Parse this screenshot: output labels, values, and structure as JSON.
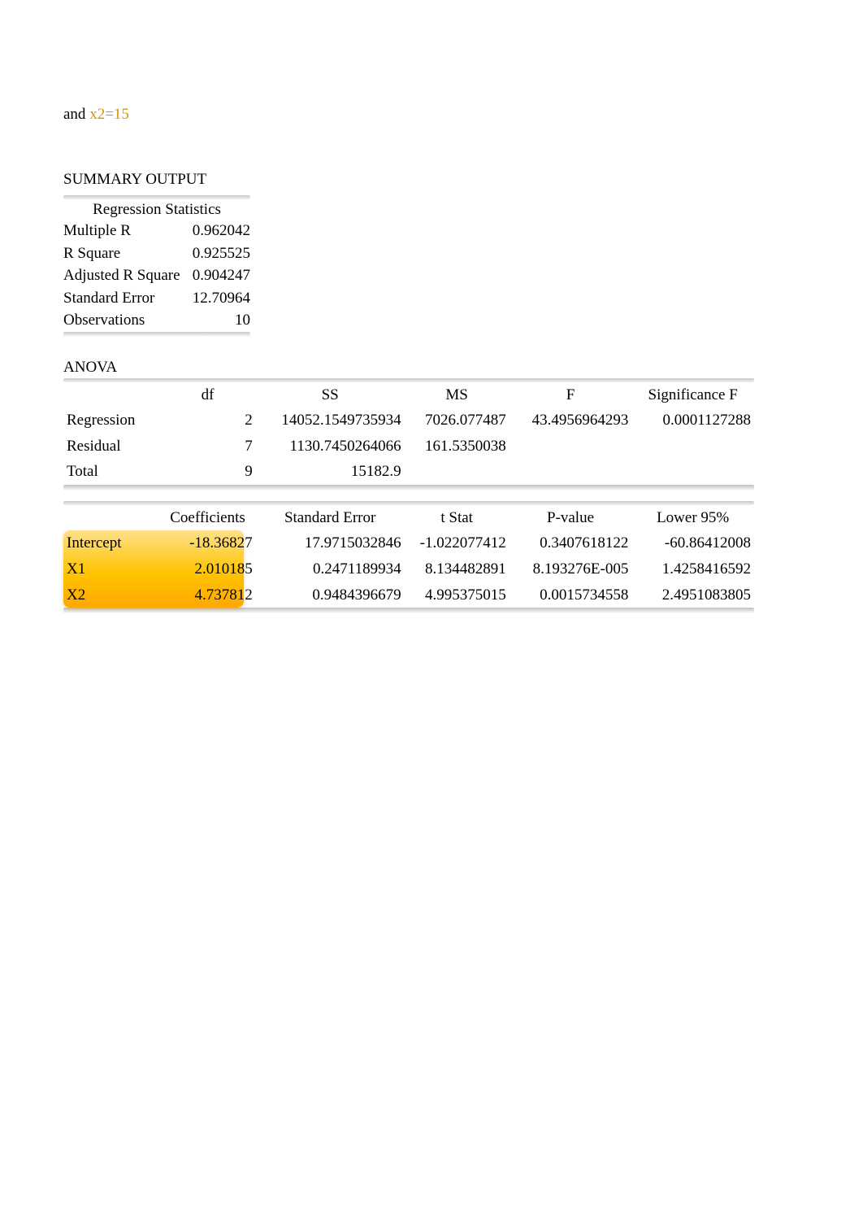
{
  "intro": {
    "and": "and",
    "equation": "x2=15"
  },
  "summary_title": "SUMMARY OUTPUT",
  "regression_stats": {
    "header": "Regression Statistics",
    "rows": [
      {
        "label": "Multiple R",
        "value": "0.962042"
      },
      {
        "label": "R Square",
        "value": "0.925525"
      },
      {
        "label": "Adjusted R Square",
        "value": "0.904247"
      },
      {
        "label": "Standard Error",
        "value": "12.70964"
      },
      {
        "label": "Observations",
        "value": "10"
      }
    ]
  },
  "anova": {
    "title": "ANOVA",
    "headers": {
      "df": "df",
      "ss": "SS",
      "ms": "MS",
      "f": "F",
      "sig": "Significance F"
    },
    "rows": [
      {
        "label": "Regression",
        "df": "2",
        "ss": "14052.1549735934",
        "ms": "7026.077487",
        "f": "43.4956964293",
        "sig": "0.0001127288"
      },
      {
        "label": "Residual",
        "df": "7",
        "ss": "1130.7450264066",
        "ms": "161.5350038",
        "f": "",
        "sig": ""
      },
      {
        "label": "Total",
        "df": "9",
        "ss": "15182.9",
        "ms": "",
        "f": "",
        "sig": ""
      }
    ]
  },
  "coefficients": {
    "headers": {
      "coef": "Coefficients",
      "se": "Standard Error",
      "t": "t Stat",
      "p": "P-value",
      "low": "Lower 95%"
    },
    "rows": [
      {
        "label": "Intercept",
        "coef": "-18.36827",
        "se": "17.9715032846",
        "t": "-1.022077412",
        "p": "0.3407618122",
        "low": "-60.86412008"
      },
      {
        "label": "X1",
        "coef": "2.010185",
        "se": "0.2471189934",
        "t": "8.134482891",
        "p": "8.193276E-005",
        "low": "1.4258416592"
      },
      {
        "label": "X2",
        "coef": "4.737812",
        "se": "0.9484396679",
        "t": "4.995375015",
        "p": "0.0015734558",
        "low": "2.4951083805"
      }
    ]
  }
}
